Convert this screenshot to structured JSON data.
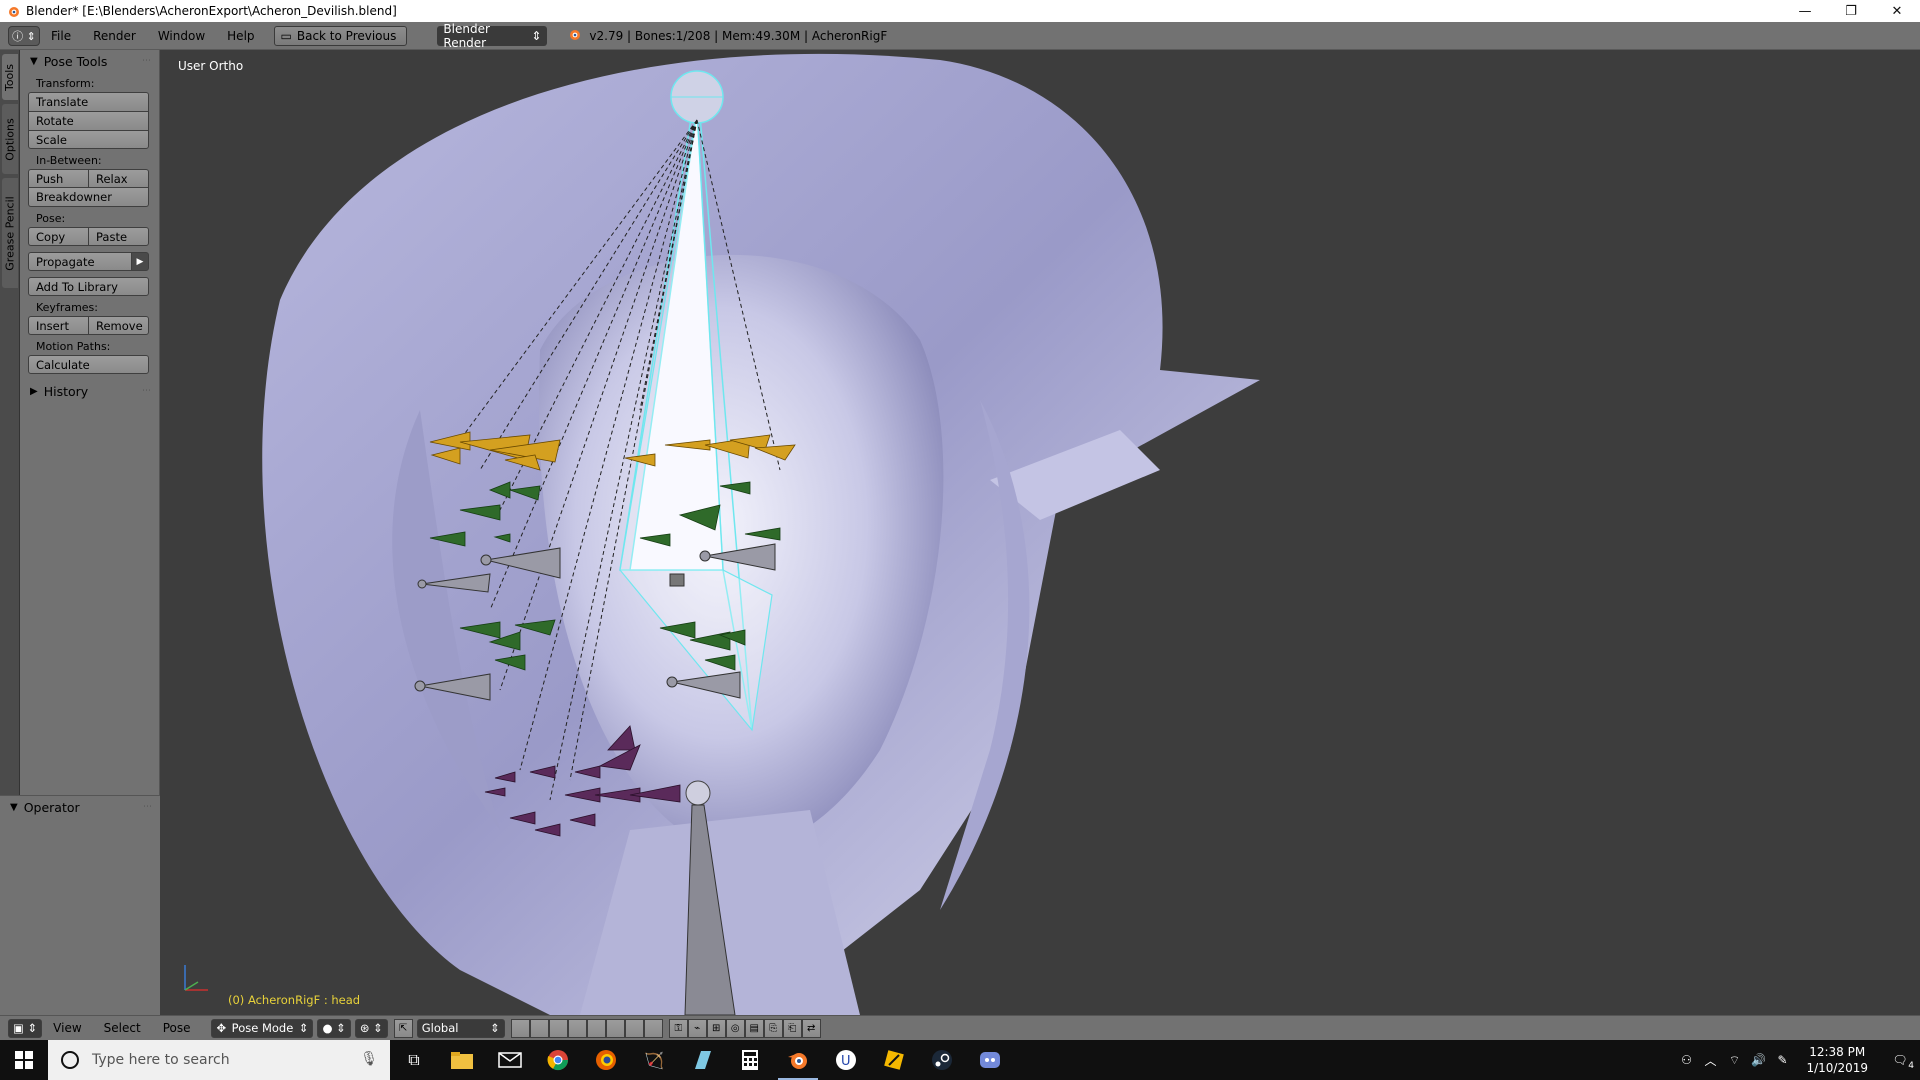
{
  "window": {
    "title": "Blender* [E:\\Blenders\\AcheronExport\\Acheron_Devilish.blend]",
    "minimize": "—",
    "restore": "❐",
    "close": "✕"
  },
  "infobar": {
    "menus": [
      "File",
      "Render",
      "Window",
      "Help"
    ],
    "back_label": "Back to Previous",
    "engine": "Blender Render",
    "stats": "v2.79 | Bones:1/208 | Mem:49.30M | AcheronRigF"
  },
  "tabs": [
    "Tools",
    "Options",
    "Grease Pencil"
  ],
  "toolshelf": {
    "panel_title": "Pose Tools",
    "transform_label": "Transform:",
    "translate": "Translate",
    "rotate": "Rotate",
    "scale": "Scale",
    "inbetween_label": "In-Between:",
    "push": "Push",
    "relax": "Relax",
    "breakdowner": "Breakdowner",
    "pose_label": "Pose:",
    "copy": "Copy",
    "paste": "Paste",
    "propagate": "Propagate",
    "add_to_library": "Add To Library",
    "keyframes_label": "Keyframes:",
    "insert": "Insert",
    "remove": "Remove",
    "motion_paths_label": "Motion Paths:",
    "calculate": "Calculate",
    "history": "History"
  },
  "operator": {
    "title": "Operator"
  },
  "viewport": {
    "view_label": "User Ortho",
    "status": "(0) AcheronRigF : head"
  },
  "vpheader": {
    "view": "View",
    "select": "Select",
    "pose": "Pose",
    "mode": "Pose Mode",
    "orientation": "Global"
  },
  "taskbar": {
    "search_placeholder": "Type here to search",
    "time": "12:38 PM",
    "date": "1/10/2019",
    "notification_count": "4"
  },
  "colors": {
    "ui_gray": "#727272",
    "viewport_bg": "#3d3d3d",
    "bone_yellow": "#d4a020",
    "bone_green": "#2f6a2a",
    "bone_purple": "#5a2a5a",
    "selected_outline": "#6fe7ef",
    "status_yellow": "#e8d23a"
  }
}
